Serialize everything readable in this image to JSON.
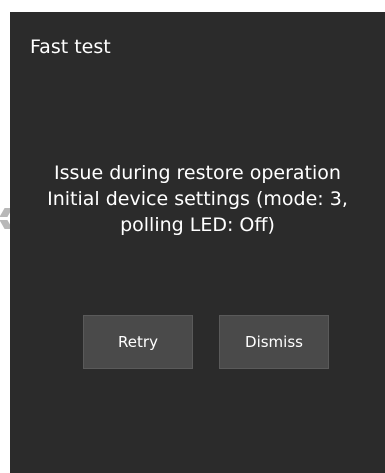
{
  "dialog": {
    "title": "Fast test",
    "message_lines": [
      "Issue during restore operation",
      "Initial device settings (mode: 3,",
      "polling LED: Off)"
    ],
    "buttons": {
      "retry": "Retry",
      "dismiss": "Dismiss"
    }
  },
  "colors": {
    "dialog_background": "#2b2b2b",
    "button_background": "#4a4a4a",
    "text": "#ffffff"
  }
}
